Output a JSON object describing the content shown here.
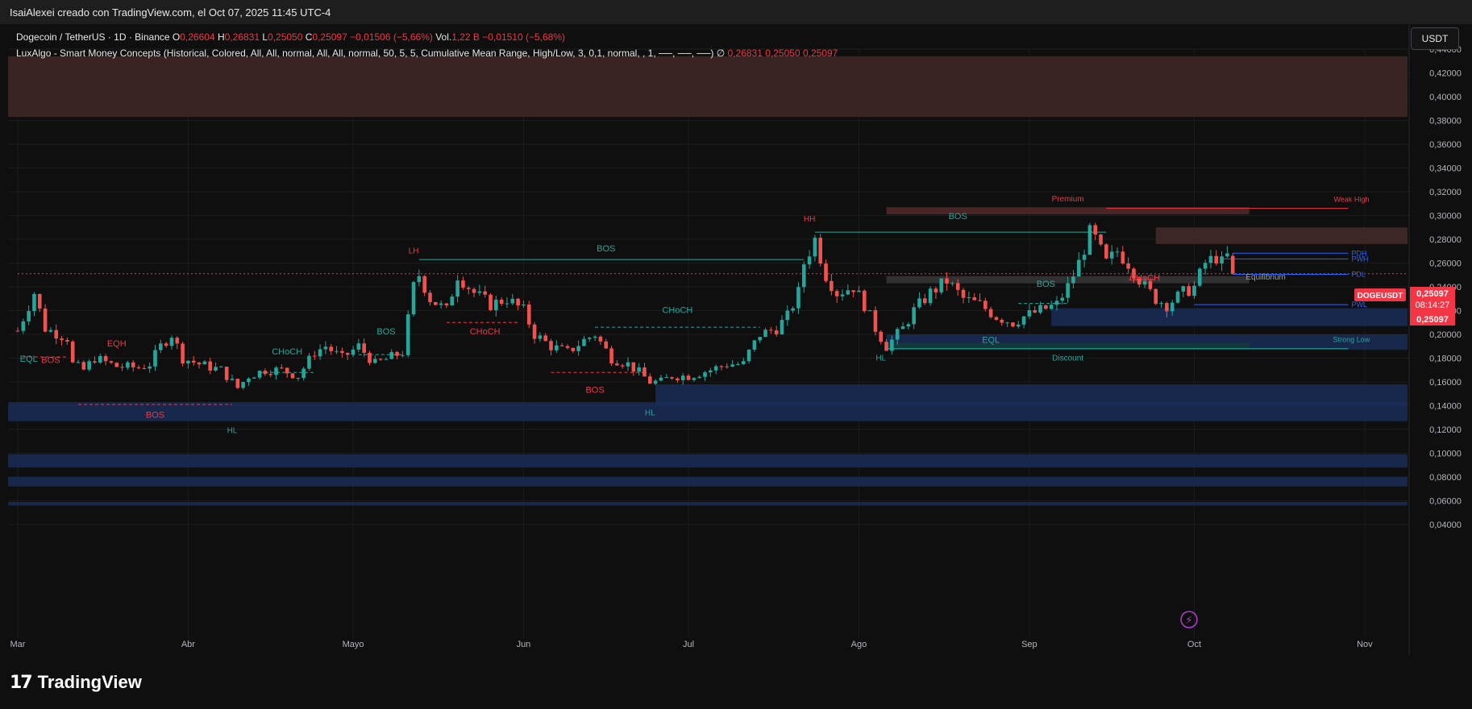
{
  "header": {
    "author_line": "IsaiAlexei creado con TradingView.com, el Oct 07, 2025 11:45 UTC-4"
  },
  "legend": {
    "symbol": "Dogecoin / TetherUS · 1D · Binance",
    "o_label": "O",
    "o_value": "0,26604",
    "h_label": "H",
    "h_value": "0,26831",
    "l_label": "L",
    "l_value": "0,25050",
    "c_label": "C",
    "c_value": "0,25097",
    "change": "−0,01506 (−5,66%)",
    "vol_label": "Vol.",
    "vol_value": "1,22 B",
    "vol_change": "−0,01510 (−5,68%)",
    "indicator": "LuxAlgo - Smart Money Concepts (Historical, Colored, All, All, normal, All, All, normal, 50, 5, 5, Cumulative Mean Range, High/Low, 3, 0,1, normal, , 1, ──, ──, ──)",
    "ind_symbol": "∅",
    "ind_v1": "0,26831",
    "ind_v2": "0,25050",
    "ind_v3": "0,25097"
  },
  "currency_button": "USDT",
  "price_tag": {
    "symbol": "DOGEUSDT",
    "price": "0,25097",
    "countdown": "08:14:27",
    "price2": "0,25097"
  },
  "branding": {
    "name": "TradingView"
  },
  "colors": {
    "up": "#26a69a",
    "down": "#ef5350",
    "bos_red": "#f23645",
    "teal_label": "#22ab94",
    "blue_zone": "#1e3a78",
    "red_zone": "#5a2a2a"
  },
  "chart_data": {
    "type": "candlestick",
    "ylim": [
      0.035,
      0.445
    ],
    "y_ticks": [
      "0,44000",
      "0,42000",
      "0,40000",
      "0,38000",
      "0,36000",
      "0,34000",
      "0,32000",
      "0,30000",
      "0,28000",
      "0,26000",
      "0,24000",
      "0,22000",
      "0,20000",
      "0,18000",
      "0,16000",
      "0,14000",
      "0,12000",
      "0,10000",
      "0,08000",
      "0,06000",
      "0,04000"
    ],
    "y_tick_values": [
      0.44,
      0.42,
      0.4,
      0.38,
      0.36,
      0.34,
      0.32,
      0.3,
      0.28,
      0.26,
      0.24,
      0.22,
      0.2,
      0.18,
      0.16,
      0.14,
      0.12,
      0.1,
      0.08,
      0.06,
      0.04
    ],
    "x_ticks": [
      {
        "label": "Mar",
        "day": 0
      },
      {
        "label": "Abr",
        "day": 31
      },
      {
        "label": "Mayo",
        "day": 61
      },
      {
        "label": "Jun",
        "day": 92
      },
      {
        "label": "Jul",
        "day": 122
      },
      {
        "label": "Ago",
        "day": 153
      },
      {
        "label": "Sep",
        "day": 184
      },
      {
        "label": "Oct",
        "day": 214
      },
      {
        "label": "Nov",
        "day": 245
      }
    ],
    "close_path": [
      [
        0,
        0.203
      ],
      [
        3,
        0.235
      ],
      [
        5,
        0.205
      ],
      [
        9,
        0.197
      ],
      [
        10,
        0.175
      ],
      [
        12,
        0.17
      ],
      [
        14,
        0.18
      ],
      [
        18,
        0.173
      ],
      [
        22,
        0.172
      ],
      [
        24,
        0.175
      ],
      [
        26,
        0.19
      ],
      [
        28,
        0.2
      ],
      [
        30,
        0.18
      ],
      [
        33,
        0.175
      ],
      [
        37,
        0.17
      ],
      [
        40,
        0.155
      ],
      [
        42,
        0.165
      ],
      [
        45,
        0.17
      ],
      [
        48,
        0.17
      ],
      [
        51,
        0.165
      ],
      [
        54,
        0.185
      ],
      [
        56,
        0.19
      ],
      [
        59,
        0.18
      ],
      [
        62,
        0.19
      ],
      [
        65,
        0.175
      ],
      [
        70,
        0.185
      ],
      [
        72,
        0.24
      ],
      [
        73,
        0.25
      ],
      [
        75,
        0.23
      ],
      [
        78,
        0.22
      ],
      [
        80,
        0.25
      ],
      [
        83,
        0.235
      ],
      [
        86,
        0.225
      ],
      [
        89,
        0.23
      ],
      [
        92,
        0.22
      ],
      [
        94,
        0.2
      ],
      [
        97,
        0.19
      ],
      [
        100,
        0.185
      ],
      [
        103,
        0.195
      ],
      [
        105,
        0.2
      ],
      [
        108,
        0.18
      ],
      [
        111,
        0.175
      ],
      [
        113,
        0.168
      ],
      [
        115,
        0.16
      ],
      [
        117,
        0.16
      ],
      [
        119,
        0.165
      ],
      [
        122,
        0.165
      ],
      [
        126,
        0.17
      ],
      [
        129,
        0.175
      ],
      [
        132,
        0.175
      ],
      [
        133,
        0.185
      ],
      [
        135,
        0.2
      ],
      [
        138,
        0.205
      ],
      [
        140,
        0.215
      ],
      [
        142,
        0.235
      ],
      [
        143,
        0.26
      ],
      [
        144,
        0.27
      ],
      [
        145,
        0.28
      ],
      [
        147,
        0.25
      ],
      [
        149,
        0.235
      ],
      [
        152,
        0.24
      ],
      [
        154,
        0.225
      ],
      [
        156,
        0.205
      ],
      [
        158,
        0.19
      ],
      [
        161,
        0.205
      ],
      [
        163,
        0.22
      ],
      [
        166,
        0.235
      ],
      [
        169,
        0.245
      ],
      [
        172,
        0.23
      ],
      [
        175,
        0.225
      ],
      [
        178,
        0.215
      ],
      [
        181,
        0.21
      ],
      [
        183,
        0.215
      ],
      [
        186,
        0.22
      ],
      [
        189,
        0.225
      ],
      [
        191,
        0.24
      ],
      [
        193,
        0.26
      ],
      [
        195,
        0.285
      ],
      [
        196,
        0.28
      ],
      [
        198,
        0.26
      ],
      [
        200,
        0.27
      ],
      [
        202,
        0.26
      ],
      [
        205,
        0.24
      ],
      [
        207,
        0.23
      ],
      [
        209,
        0.225
      ],
      [
        212,
        0.235
      ],
      [
        214,
        0.24
      ],
      [
        216,
        0.26
      ],
      [
        218,
        0.265
      ],
      [
        219,
        0.26
      ],
      [
        220,
        0.2658
      ],
      [
        221,
        0.251
      ]
    ],
    "last_candle": {
      "open": 0.26604,
      "high": 0.26831,
      "low": 0.2505,
      "close": 0.25097
    },
    "zones": [
      {
        "kind": "supply",
        "from_day": -2,
        "to_day": 262,
        "low": 0.383,
        "high": 0.434
      },
      {
        "kind": "premium",
        "from_day": 158,
        "to_day": 224,
        "low": 0.301,
        "high": 0.307
      },
      {
        "kind": "supply-small",
        "from_day": 207,
        "to_day": 262,
        "low": 0.276,
        "high": 0.29
      },
      {
        "kind": "equilibrium",
        "from_day": 158,
        "to_day": 224,
        "low": 0.243,
        "high": 0.249
      },
      {
        "kind": "demand",
        "from_day": 188,
        "to_day": 262,
        "low": 0.207,
        "high": 0.222
      },
      {
        "kind": "demand",
        "from_day": 158,
        "to_day": 262,
        "low": 0.187,
        "high": 0.2
      },
      {
        "kind": "discount",
        "from_day": 158,
        "to_day": 224,
        "low": 0.187,
        "high": 0.193
      },
      {
        "kind": "demand",
        "from_day": 116,
        "to_day": 262,
        "low": 0.14,
        "high": 0.158
      },
      {
        "kind": "demand",
        "from_day": -2,
        "to_day": 262,
        "low": 0.127,
        "high": 0.143
      },
      {
        "kind": "demand",
        "from_day": -2,
        "to_day": 262,
        "low": 0.088,
        "high": 0.099
      },
      {
        "kind": "demand",
        "from_day": -2,
        "to_day": 262,
        "low": 0.072,
        "high": 0.08
      },
      {
        "kind": "demand",
        "from_day": -2,
        "to_day": 262,
        "low": 0.056,
        "high": 0.059
      }
    ],
    "levels": [
      {
        "label": "Weak High",
        "day_from": 198,
        "day_to": 242,
        "price": 0.306,
        "color": "#f23645"
      },
      {
        "label": "PDH",
        "day_from": 221,
        "day_to": 242,
        "price": 0.2683,
        "color": "#2962ff"
      },
      {
        "label": "PWH",
        "day_from": 219,
        "day_to": 242,
        "price": 0.2635,
        "color": "#2962ff"
      },
      {
        "label": "PDL",
        "day_from": 221,
        "day_to": 242,
        "price": 0.2505,
        "color": "#2962ff"
      },
      {
        "label": "PWL",
        "day_from": 214,
        "day_to": 242,
        "price": 0.225,
        "color": "#2962ff"
      },
      {
        "label": "Strong Low",
        "day_from": 158,
        "day_to": 242,
        "price": 0.188,
        "color": "#26a69a"
      }
    ],
    "structure_lines": [
      {
        "day_from": 73,
        "day_to": 143,
        "price": 0.263,
        "color": "#26a69a",
        "dash": false
      },
      {
        "day_from": 145,
        "day_to": 198,
        "price": 0.286,
        "color": "#26a69a",
        "dash": false
      },
      {
        "day_from": 105,
        "day_to": 135,
        "price": 0.206,
        "color": "#26a69a",
        "dash": true
      },
      {
        "day_from": 44,
        "day_to": 54,
        "price": 0.168,
        "color": "#26a69a",
        "dash": true
      },
      {
        "day_from": 62,
        "day_to": 70,
        "price": 0.183,
        "color": "#26a69a",
        "dash": true
      },
      {
        "day_from": 182,
        "day_to": 191,
        "price": 0.226,
        "color": "#26a69a",
        "dash": true
      },
      {
        "day_from": 1,
        "day_to": 9,
        "price": 0.181,
        "color": "#f23645",
        "dash": true
      },
      {
        "day_from": 11,
        "day_to": 39,
        "price": 0.141,
        "color": "#f23645",
        "dash": true
      },
      {
        "day_from": 78,
        "day_to": 91,
        "price": 0.21,
        "color": "#f23645",
        "dash": true
      },
      {
        "day_from": 97,
        "day_to": 114,
        "price": 0.168,
        "color": "#f23645",
        "dash": true
      },
      {
        "day_from": 202,
        "day_to": 207,
        "price": 0.246,
        "color": "#f23645",
        "dash": true
      },
      {
        "day_from": 0,
        "day_to": 262,
        "price": 0.251,
        "color": "#f23645",
        "dash": true
      }
    ],
    "annotations": [
      {
        "text": "EQL",
        "day": 2,
        "price": 0.177,
        "color": "#26a69a"
      },
      {
        "text": "BOS",
        "day": 6,
        "price": 0.176,
        "color": "#f23645"
      },
      {
        "text": "EQH",
        "day": 18,
        "price": 0.19,
        "color": "#f23645"
      },
      {
        "text": "BOS",
        "day": 25,
        "price": 0.13,
        "color": "#f23645"
      },
      {
        "text": "HL",
        "day": 39,
        "price": 0.117,
        "color": "#26a69a"
      },
      {
        "text": "CHoCH",
        "day": 49,
        "price": 0.183,
        "color": "#26a69a"
      },
      {
        "text": "BOS",
        "day": 67,
        "price": 0.2,
        "color": "#26a69a"
      },
      {
        "text": "LH",
        "day": 72,
        "price": 0.268,
        "color": "#f23645"
      },
      {
        "text": "BOS",
        "day": 107,
        "price": 0.27,
        "color": "#26a69a"
      },
      {
        "text": "CHoCH",
        "day": 85,
        "price": 0.2,
        "color": "#f23645"
      },
      {
        "text": "CHoCH",
        "day": 120,
        "price": 0.218,
        "color": "#26a69a"
      },
      {
        "text": "BOS",
        "day": 105,
        "price": 0.151,
        "color": "#f23645"
      },
      {
        "text": "HL",
        "day": 115,
        "price": 0.132,
        "color": "#26a69a"
      },
      {
        "text": "HH",
        "day": 144,
        "price": 0.295,
        "color": "#f23645"
      },
      {
        "text": "Premium",
        "day": 191,
        "price": 0.312,
        "color": "#f23645"
      },
      {
        "text": "BOS",
        "day": 171,
        "price": 0.297,
        "color": "#26a69a"
      },
      {
        "text": "BOS",
        "day": 187,
        "price": 0.24,
        "color": "#26a69a"
      },
      {
        "text": "CHoCH",
        "day": 205,
        "price": 0.245,
        "color": "#f23645"
      },
      {
        "text": "Equilibrium",
        "day": 227,
        "price": 0.246,
        "color": "#9aa0a6"
      },
      {
        "text": "EQL",
        "day": 177,
        "price": 0.193,
        "color": "#26a69a"
      },
      {
        "text": "Discount",
        "day": 191,
        "price": 0.178,
        "color": "#26a69a"
      },
      {
        "text": "HL",
        "day": 157,
        "price": 0.178,
        "color": "#26a69a"
      }
    ]
  }
}
